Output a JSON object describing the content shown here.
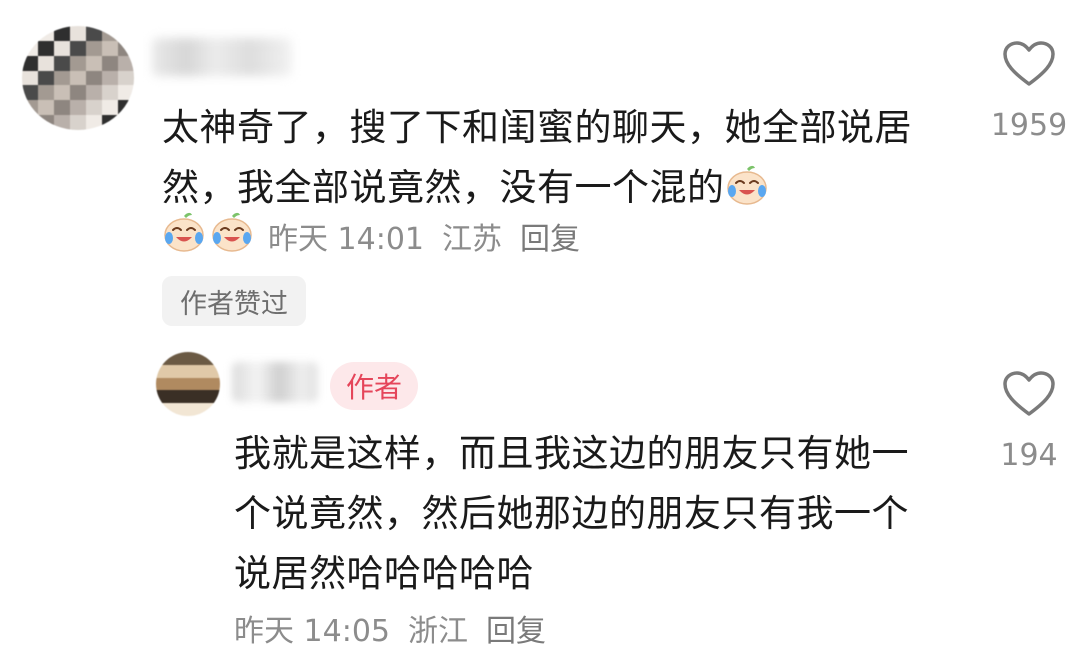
{
  "comments": [
    {
      "text": "太神奇了，搜了下和闺蜜的聊天，她全部说居然，我全部说竟然，没有一个混的",
      "trailing_emoji": "crying-laughing-emoji",
      "meta_emojis": [
        "crying-laughing-emoji",
        "crying-laughing-emoji"
      ],
      "time": "昨天 14:01",
      "location": "江苏",
      "reply_label": "回复",
      "badge": "作者赞过",
      "like_count": "1959"
    },
    {
      "author_tag": "作者",
      "text": "我就是这样，而且我这边的朋友只有她一个说竟然，然后她那边的朋友只有我一个说居然哈哈哈哈哈",
      "time": "昨天 14:05",
      "location": "浙江",
      "reply_label": "回复",
      "like_count": "194"
    }
  ],
  "colors": {
    "author_tag_bg": "#fde8ea",
    "author_tag_text": "#e5455a",
    "meta_text": "#8c8c8c"
  }
}
